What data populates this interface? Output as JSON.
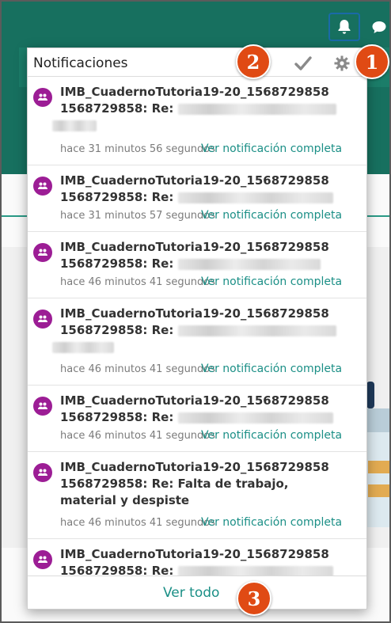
{
  "header": {
    "title": "Notificaciones",
    "mark_all_read_icon": "check-icon",
    "settings_icon": "gear-icon"
  },
  "topbar": {
    "bell_icon": "bell-icon",
    "chat_icon": "chat-icon"
  },
  "notifications": [
    {
      "subject_line1": "IMB_CuadernoTutoria19-20_1568729858",
      "subject_line2": "1568729858: Re:",
      "time": "hace 31 minutos 56 segundos",
      "link": "Ver notificación completa"
    },
    {
      "subject_line1": "IMB_CuadernoTutoria19-20_1568729858",
      "subject_line2": "1568729858: Re:",
      "time": "hace 31 minutos 57 segundos",
      "link": "Ver notificación completa"
    },
    {
      "subject_line1": "IMB_CuadernoTutoria19-20_1568729858",
      "subject_line2": "1568729858: Re:",
      "time": "hace 46 minutos 41 segundos",
      "link": "Ver notificación completa"
    },
    {
      "subject_line1": "IMB_CuadernoTutoria19-20_1568729858",
      "subject_line2": "1568729858: Re:",
      "time": "hace 46 minutos 41 segundos",
      "link": "Ver notificación completa"
    },
    {
      "subject_line1": "IMB_CuadernoTutoria19-20_1568729858",
      "subject_line2": "1568729858: Re:",
      "time": "hace 46 minutos 41 segundos",
      "link": "Ver notificación completa"
    },
    {
      "subject_line1": "IMB_CuadernoTutoria19-20_1568729858",
      "subject_line2": "1568729858: Re: Falta de trabajo,",
      "subject_line3": "material y despiste",
      "time": "hace 46 minutos 41 segundos",
      "link": "Ver notificación completa"
    },
    {
      "subject_line1": "IMB_CuadernoTutoria19-20_1568729858",
      "subject_line2": "1568729858: Re:"
    }
  ],
  "footer": {
    "see_all": "Ver todo"
  },
  "callouts": [
    "1",
    "2",
    "3"
  ],
  "colors": {
    "accent": "#1b8f86",
    "topbar": "#17705f",
    "icon_bg": "#9c1d95",
    "callout": "#e04a14"
  }
}
